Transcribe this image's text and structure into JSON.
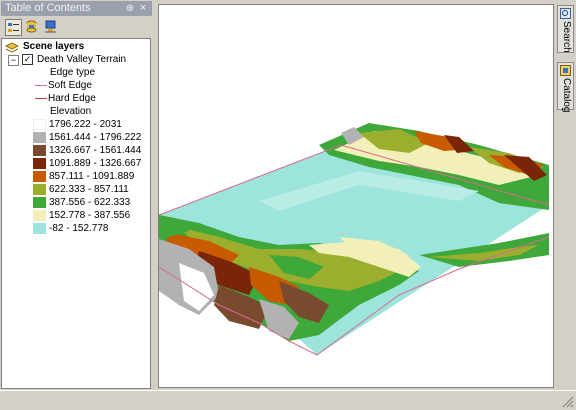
{
  "toc": {
    "title": "Table of Contents",
    "pin_glyph": "⊕",
    "close_glyph": "×",
    "toolbar": [
      "list-by-drawing-order-icon",
      "list-by-source-icon",
      "list-by-visibility-icon"
    ],
    "scene_layers_label": "Scene layers",
    "layer": {
      "name": "Death Valley Terrain",
      "checked": true,
      "expand_glyph": "⊟"
    },
    "edge_type_label": "Edge type",
    "edges": [
      {
        "label": "Soft Edge",
        "color": "#d86a8e"
      },
      {
        "label": "Hard Edge",
        "color": "#b04040"
      }
    ],
    "elevation_label": "Elevation",
    "classes": [
      {
        "range": "1796.222 - 2031",
        "color": "#ffffff"
      },
      {
        "range": "1561.444 - 1796.222",
        "color": "#b2b2b2"
      },
      {
        "range": "1326.667 - 1561.444",
        "color": "#7a4a2e"
      },
      {
        "range": "1091.889 - 1326.667",
        "color": "#7a2408"
      },
      {
        "range": "857.111 - 1091.889",
        "color": "#c85a00"
      },
      {
        "range": "622.333 - 857.111",
        "color": "#9cae2e"
      },
      {
        "range": "387.556 - 622.333",
        "color": "#3ea83a"
      },
      {
        "range": "152.778 - 387.556",
        "color": "#f2f0b8"
      },
      {
        "range": "-82 - 152.778",
        "color": "#9ce4dc"
      }
    ]
  },
  "dock": {
    "tabs": [
      "Search",
      "Catalog"
    ]
  }
}
